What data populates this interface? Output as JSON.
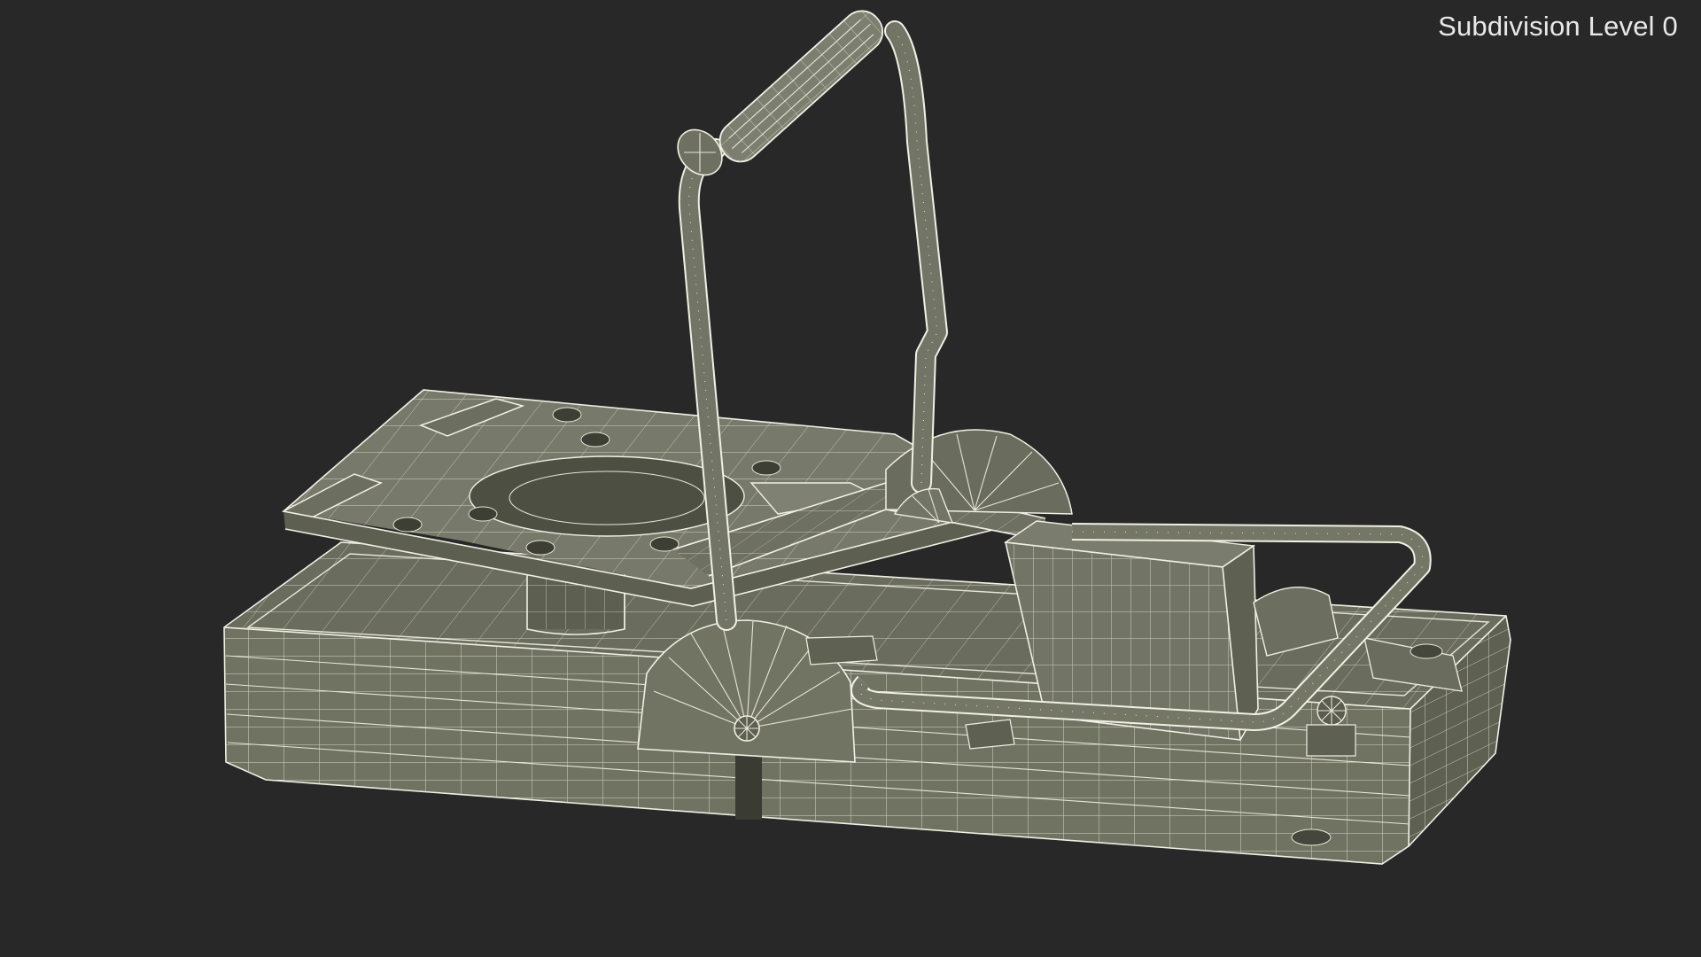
{
  "overlay": {
    "subdivision_label": "Subdivision Level 0"
  },
  "colors": {
    "background": "#282828",
    "surface_light": "#7a7b6c",
    "surface_mid": "#686a5b",
    "surface_dark": "#55574a",
    "wire": "#e6e6d6",
    "label_text": "#e8e8e8"
  }
}
